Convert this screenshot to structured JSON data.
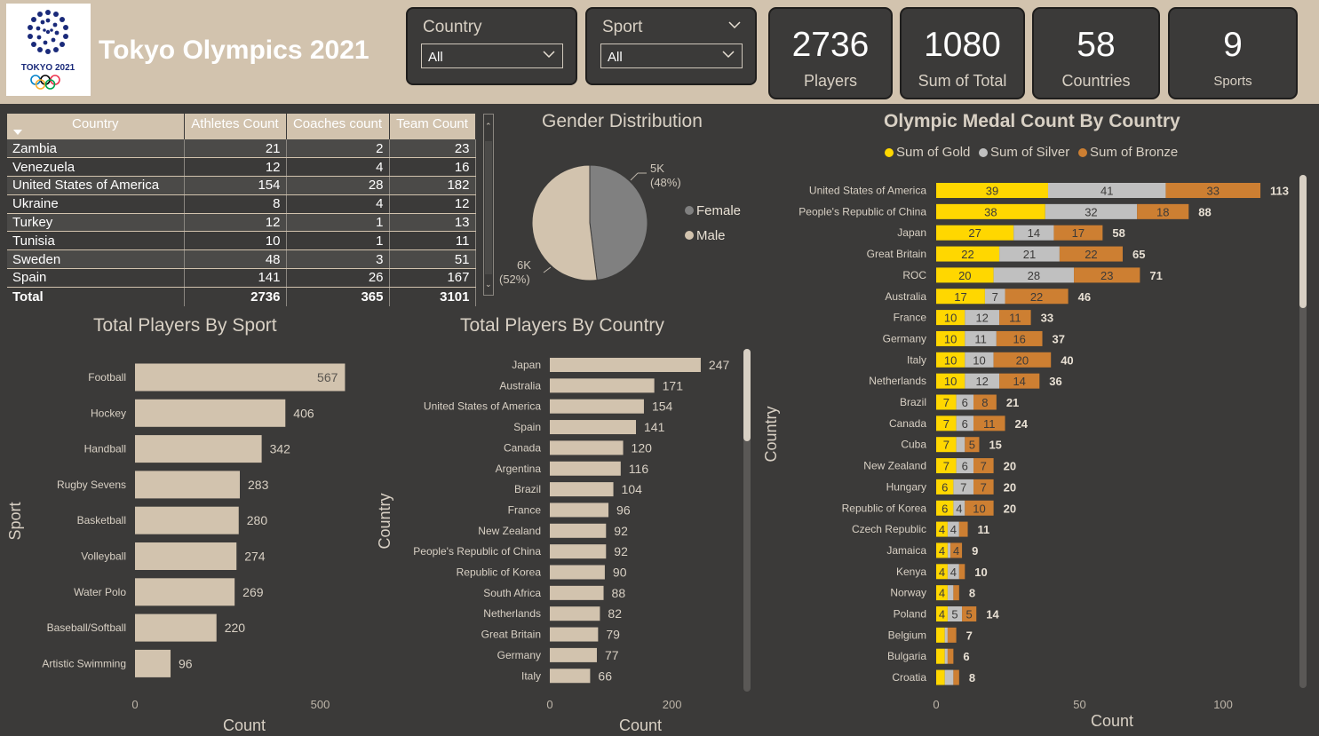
{
  "app": {
    "title": "Tokyo Olympics 2021",
    "logo_text": "TOKYO 2021",
    "colors": {
      "header_bg": "#d2c3ae",
      "page_bg": "#3b3a39",
      "bar": "#d2c3ae",
      "gold": "#ffd700",
      "silver": "#c0c0c0",
      "bronze": "#cd7f32",
      "female": "#808080",
      "male": "#d2c3ae"
    }
  },
  "slicers": [
    {
      "label": "Country",
      "value": "All"
    },
    {
      "label": "Sport",
      "value": "All"
    }
  ],
  "kpis": [
    {
      "value": "2736",
      "label": "Players"
    },
    {
      "value": "1080",
      "label": "Sum of Total"
    },
    {
      "value": "58",
      "label": "Countries"
    },
    {
      "value": "9",
      "label": "Sports"
    }
  ],
  "table": {
    "columns": [
      "Country",
      "Athletes Count",
      "Coaches count",
      "Team Count"
    ],
    "rows": [
      [
        "Zambia",
        "21",
        "2",
        "23"
      ],
      [
        "Venezuela",
        "12",
        "4",
        "16"
      ],
      [
        "United States of America",
        "154",
        "28",
        "182"
      ],
      [
        "Ukraine",
        "8",
        "4",
        "12"
      ],
      [
        "Turkey",
        "12",
        "1",
        "13"
      ],
      [
        "Tunisia",
        "10",
        "1",
        "11"
      ],
      [
        "Sweden",
        "48",
        "3",
        "51"
      ],
      [
        "Spain",
        "141",
        "26",
        "167"
      ]
    ],
    "total": [
      "Total",
      "2736",
      "365",
      "3101"
    ]
  },
  "chart_data": [
    {
      "type": "pie",
      "title": "Gender Distribution",
      "categories": [
        "Female",
        "Male"
      ],
      "values": [
        5000,
        6000
      ],
      "percent_labels": [
        "(48%)",
        "(52%)"
      ],
      "value_labels": [
        "5K",
        "6K"
      ],
      "percents": [
        48,
        52
      ],
      "legend_position": "right"
    },
    {
      "type": "bar",
      "title": "Total Players By Sport",
      "xlabel": "Count",
      "ylabel": "Sport",
      "categories": [
        "Football",
        "Hockey",
        "Handball",
        "Rugby Sevens",
        "Basketball",
        "Volleyball",
        "Water Polo",
        "Baseball/Softball",
        "Artistic Swimming"
      ],
      "values": [
        567,
        406,
        342,
        283,
        280,
        274,
        269,
        220,
        96
      ],
      "xlim": [
        0,
        560
      ],
      "xticks": [
        "0",
        "500"
      ],
      "xtick_values": [
        0,
        500
      ]
    },
    {
      "type": "bar",
      "title": "Total Players By Country",
      "xlabel": "Count",
      "ylabel": "Country",
      "categories": [
        "Japan",
        "Australia",
        "United States of America",
        "Spain",
        "Canada",
        "Argentina",
        "Brazil",
        "France",
        "New Zealand",
        "People's Republic of China",
        "Republic of Korea",
        "South Africa",
        "Netherlands",
        "Great Britain",
        "Germany",
        "Italy"
      ],
      "values": [
        247,
        171,
        154,
        141,
        120,
        116,
        104,
        96,
        92,
        92,
        90,
        88,
        82,
        79,
        77,
        66
      ],
      "xlim": [
        0,
        250
      ],
      "xticks": [
        "0",
        "200"
      ],
      "xtick_values": [
        0,
        200
      ]
    },
    {
      "type": "bar",
      "stacked": true,
      "title": "Olympic Medal Count By Country",
      "xlabel": "Count",
      "ylabel": "Country",
      "legend_position": "top",
      "categories": [
        "United States of America",
        "People's Republic of China",
        "Japan",
        "Great Britain",
        "ROC",
        "Australia",
        "France",
        "Germany",
        "Italy",
        "Netherlands",
        "Brazil",
        "Canada",
        "Cuba",
        "New Zealand",
        "Hungary",
        "Republic of Korea",
        "Czech Republic",
        "Jamaica",
        "Kenya",
        "Norway",
        "Poland",
        "Belgium",
        "Bulgaria",
        "Croatia"
      ],
      "series": [
        {
          "name": "Sum of Gold",
          "values": [
            39,
            38,
            27,
            22,
            20,
            17,
            10,
            10,
            10,
            10,
            7,
            7,
            7,
            7,
            6,
            6,
            4,
            4,
            4,
            4,
            4,
            3,
            3,
            3
          ]
        },
        {
          "name": "Sum of Silver",
          "values": [
            41,
            32,
            14,
            21,
            28,
            7,
            12,
            11,
            10,
            12,
            6,
            6,
            3,
            6,
            7,
            4,
            4,
            1,
            4,
            2,
            5,
            1,
            1,
            3
          ]
        },
        {
          "name": "Sum of Bronze",
          "values": [
            33,
            18,
            17,
            22,
            23,
            22,
            11,
            16,
            20,
            14,
            8,
            11,
            5,
            7,
            7,
            10,
            3,
            4,
            2,
            2,
            5,
            3,
            2,
            2
          ]
        }
      ],
      "totals": [
        113,
        88,
        58,
        65,
        71,
        46,
        33,
        37,
        40,
        36,
        21,
        24,
        15,
        20,
        20,
        20,
        11,
        9,
        10,
        8,
        14,
        7,
        6,
        8
      ],
      "xlim": [
        0,
        115
      ],
      "xticks": [
        "0",
        "50",
        "100"
      ],
      "xtick_values": [
        0,
        50,
        100
      ]
    }
  ]
}
